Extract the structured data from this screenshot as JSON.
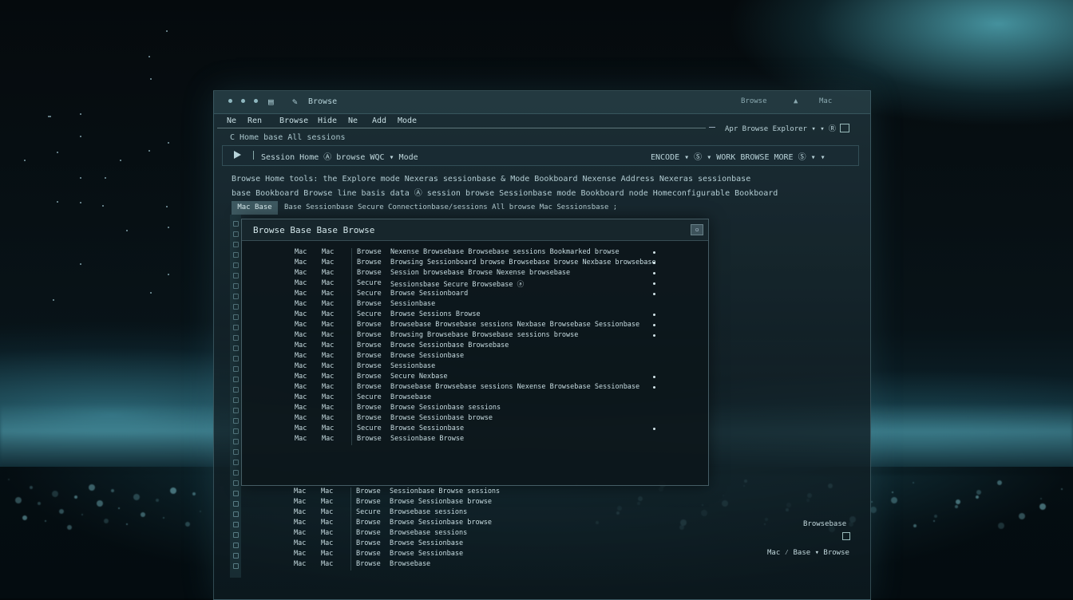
{
  "window": {
    "title": "Browse",
    "right_label": "Browse",
    "right_icon": "▲",
    "right_label_2": "Mac"
  },
  "menu": {
    "items": [
      "Ne",
      "Ren",
      "Browse",
      "Hide",
      "Ne",
      "Add",
      "Mode"
    ],
    "right_text": "Apr Browse Explorer ▾ ▾ Ⓡ"
  },
  "breadcrumb": "C Home  base  All  sessions",
  "toolbar": {
    "label": "Session  Home  Ⓐ  browse  WQC  ▾  Mode",
    "right_text": "ENCODE  ▾  Ⓢ  ▾  WORK BROWSE  MORE  Ⓢ  ▾  ▾"
  },
  "info": [
    "Browse Home tools: the Explore mode Nexeras sessionbase & Mode Bookboard  Nexense Address Nexeras sessionbase",
    "base Bookboard Browse line basis data Ⓐ session browse Sessionbase mode Bookboard node Homeconfigurable Bookboard"
  ],
  "tab": {
    "active": "Mac Base",
    "text": "Base Sessionbase  Secure  Connectionbase/sessions  All  browse  Mac Sessionsbase  ;"
  },
  "dialog": {
    "title": "Browse  Base  Base Browse",
    "close_label": "▫"
  },
  "rows": [
    {
      "a": "Mac",
      "b": "Mac",
      "c": "Browse",
      "d": "Nexense Browsebase Browsebase sessions Bookmarked browse",
      "dot": true
    },
    {
      "a": "Mac",
      "b": "Mac",
      "c": "Browse",
      "d": "Browsing Sessionboard browse Browsebase browse Nexbase browsebase",
      "dot": true
    },
    {
      "a": "Mac",
      "b": "Mac",
      "c": "Browse",
      "d": "Session browsebase Browse Nexense browsebase",
      "dot": true
    },
    {
      "a": "Mac",
      "b": "Mac",
      "c": "Secure",
      "d": "Sessionsbase Secure Browsebase ⓐ",
      "dot": true
    },
    {
      "a": "Mac",
      "b": "Mac",
      "c": "Secure",
      "d": "Browse Sessionboard",
      "dot": true
    },
    {
      "a": "Mac",
      "b": "Mac",
      "c": "Browse",
      "d": "Sessionbase",
      "dot": false
    },
    {
      "a": "Mac",
      "b": "Mac",
      "c": "Secure",
      "d": "Browse Sessions Browse",
      "dot": true
    },
    {
      "a": "Mac",
      "b": "Mac",
      "c": "Browse",
      "d": "Browsebase Browsebase sessions Nexbase Browsebase Sessionbase",
      "dot": true
    },
    {
      "a": "Mac",
      "b": "Mac",
      "c": "Browse",
      "d": "Browsing Browsebase Browsebase sessions browse",
      "dot": true
    },
    {
      "a": "Mac",
      "b": "Mac",
      "c": "Browse",
      "d": "Browse Sessionbase Browsebase",
      "dot": false
    },
    {
      "a": "Mac",
      "b": "Mac",
      "c": "Browse",
      "d": "Browse Sessionbase",
      "dot": false
    },
    {
      "a": "Mac",
      "b": "Mac",
      "c": "Browse",
      "d": "Sessionbase",
      "dot": false
    },
    {
      "a": "Mac",
      "b": "Mac",
      "c": "Browse",
      "d": "Secure Nexbase",
      "dot": true
    },
    {
      "a": "Mac",
      "b": "Mac",
      "c": "Browse",
      "d": "Browsebase Browsebase sessions Nexense Browsebase Sessionbase",
      "dot": true
    },
    {
      "a": "Mac",
      "b": "Mac",
      "c": "Secure",
      "d": "Browsebase",
      "dot": false
    },
    {
      "a": "Mac",
      "b": "Mac",
      "c": "Browse",
      "d": "Browse Sessionbase sessions",
      "dot": false
    },
    {
      "a": "Mac",
      "b": "Mac",
      "c": "Browse",
      "d": "Browse Sessionbase browse",
      "dot": false
    },
    {
      "a": "Mac",
      "b": "Mac",
      "c": "Secure",
      "d": "Browse Sessionbase",
      "dot": true
    },
    {
      "a": "Mac",
      "b": "Mac",
      "c": "Browse",
      "d": "Sessionbase Browse",
      "dot": false
    }
  ],
  "rows_below": [
    {
      "a": "Mac",
      "b": "Mac",
      "c": "Browse",
      "d": "Sessionbase Browse sessions"
    },
    {
      "a": "Mac",
      "b": "Mac",
      "c": "Browse",
      "d": "Browse Sessionbase browse"
    },
    {
      "a": "Mac",
      "b": "Mac",
      "c": "Secure",
      "d": "Browsebase sessions"
    },
    {
      "a": "Mac",
      "b": "Mac",
      "c": "Browse",
      "d": "Browse Sessionbase browse"
    },
    {
      "a": "Mac",
      "b": "Mac",
      "c": "Browse",
      "d": "Browsebase sessions"
    },
    {
      "a": "Mac",
      "b": "Mac",
      "c": "Browse",
      "d": "Browse Sessionbase"
    },
    {
      "a": "Mac",
      "b": "Mac",
      "c": "Browse",
      "d": "Browse Sessionbase"
    },
    {
      "a": "Mac",
      "b": "Mac",
      "c": "Browse",
      "d": "Browsebase"
    }
  ],
  "status": {
    "label1": "Browsebase",
    "label2": "Mac  ⁄  Base  ▾  Browse"
  }
}
